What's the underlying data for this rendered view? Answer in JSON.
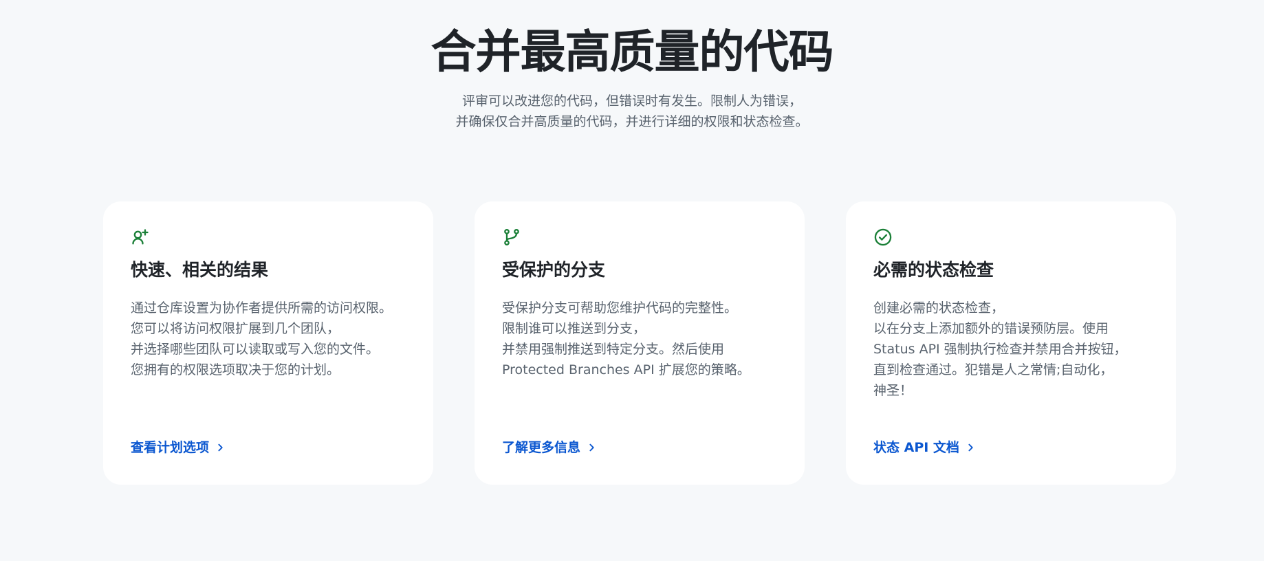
{
  "hero": {
    "title": "合并最高质量的代码",
    "subtitle_lines": [
      "评审可以改进您的代码，但错误时有发生。限制人为错误，",
      "并确保仅合并高质量的代码，并进行详细的权限和状态检查。"
    ]
  },
  "colors": {
    "background": "#f6f8fa",
    "card_background": "#ffffff",
    "title": "#1f2328",
    "body_text": "#59636e",
    "icon": "#1a7f37",
    "link": "#0b57d0"
  },
  "cards": [
    {
      "icon": "person-add-icon",
      "title": "快速、相关的结果",
      "description_lines": [
        "通过仓库设置为协作者提供所需的访问权限。",
        "您可以将访问权限扩展到几个团队，",
        "并选择哪些团队可以读取或写入您的文件。",
        "您拥有的权限选项取决于您的计划。"
      ],
      "link_label": "查看计划选项"
    },
    {
      "icon": "git-branch-icon",
      "title": "受保护的分支",
      "description_lines": [
        "受保护分支可帮助您维护代码的完整性。",
        "限制谁可以推送到分支，",
        "并禁用强制推送到特定分支。然后使用",
        "Protected Branches API 扩展您的策略。"
      ],
      "link_label": "了解更多信息"
    },
    {
      "icon": "check-circle-icon",
      "title": "必需的状态检查",
      "description_lines": [
        "创建必需的状态检查，",
        "以在分支上添加额外的错误预防层。使用",
        "Status API 强制执行检查并禁用合并按钮，",
        "直到检查通过。犯错是人之常情;自动化，",
        "神圣！"
      ],
      "link_label": "状态 API 文档"
    }
  ]
}
